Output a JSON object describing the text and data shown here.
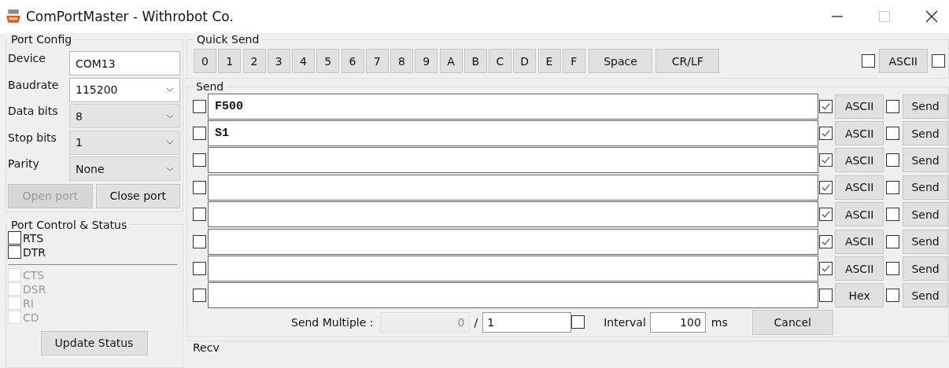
{
  "window": {
    "title": "ComPortMaster - Withrobot Co."
  },
  "port_config": {
    "title": "Port Config",
    "fields": [
      {
        "label": "Device",
        "kind": "text",
        "value": "COM13"
      },
      {
        "label": "Baudrate",
        "kind": "editable-combo",
        "value": "115200"
      },
      {
        "label": "Data bits",
        "kind": "combo",
        "value": "8"
      },
      {
        "label": "Stop bits",
        "kind": "combo",
        "value": "1"
      },
      {
        "label": "Parity",
        "kind": "combo",
        "value": "None"
      }
    ],
    "buttons": [
      {
        "label": "Open port",
        "disabled": true
      },
      {
        "label": "Close port",
        "disabled": false
      }
    ]
  },
  "port_control": {
    "title": "Port Control & Status",
    "lines": [
      {
        "label": "RTS",
        "checked": false
      },
      {
        "label": "DTR",
        "checked": false
      }
    ],
    "status": [
      {
        "label": "CTS",
        "checked": false
      },
      {
        "label": "DSR",
        "checked": false
      },
      {
        "label": "RI",
        "checked": false
      },
      {
        "label": "CD",
        "checked": false
      }
    ],
    "button": "Update Status"
  },
  "quick_send": {
    "title": "Quick Send",
    "keys": [
      "0",
      "1",
      "2",
      "3",
      "4",
      "5",
      "6",
      "7",
      "8",
      "9",
      "A",
      "B",
      "C",
      "D",
      "E",
      "F",
      "Space",
      "CR/LF"
    ],
    "format_checked": false,
    "format": "ASCII",
    "append_checked": false
  },
  "send": {
    "title": "Send",
    "rows": [
      {
        "checked": false,
        "value": "F500",
        "format_checked": true,
        "format": "ASCII",
        "append_checked": false,
        "button": "Send"
      },
      {
        "checked": false,
        "value": "S1",
        "format_checked": true,
        "format": "ASCII",
        "append_checked": false,
        "button": "Send"
      },
      {
        "checked": false,
        "value": "",
        "format_checked": true,
        "format": "ASCII",
        "append_checked": false,
        "button": "Send"
      },
      {
        "checked": false,
        "value": "",
        "format_checked": true,
        "format": "ASCII",
        "append_checked": false,
        "button": "Send"
      },
      {
        "checked": false,
        "value": "",
        "format_checked": true,
        "format": "ASCII",
        "append_checked": false,
        "button": "Send"
      },
      {
        "checked": false,
        "value": "",
        "format_checked": true,
        "format": "ASCII",
        "append_checked": false,
        "button": "Send"
      },
      {
        "checked": false,
        "value": "",
        "format_checked": true,
        "format": "ASCII",
        "append_checked": false,
        "button": "Send"
      },
      {
        "checked": false,
        "value": "",
        "format_checked": false,
        "format": "Hex",
        "append_checked": false,
        "button": "Send"
      }
    ],
    "multiple": {
      "label": "Send Multiple :",
      "count": "0",
      "separator": "/",
      "total": "1",
      "checked": false,
      "interval_label": "Interval",
      "interval": "100",
      "unit": "ms",
      "cancel": "Cancel"
    }
  },
  "recv": {
    "title": "Recv"
  }
}
